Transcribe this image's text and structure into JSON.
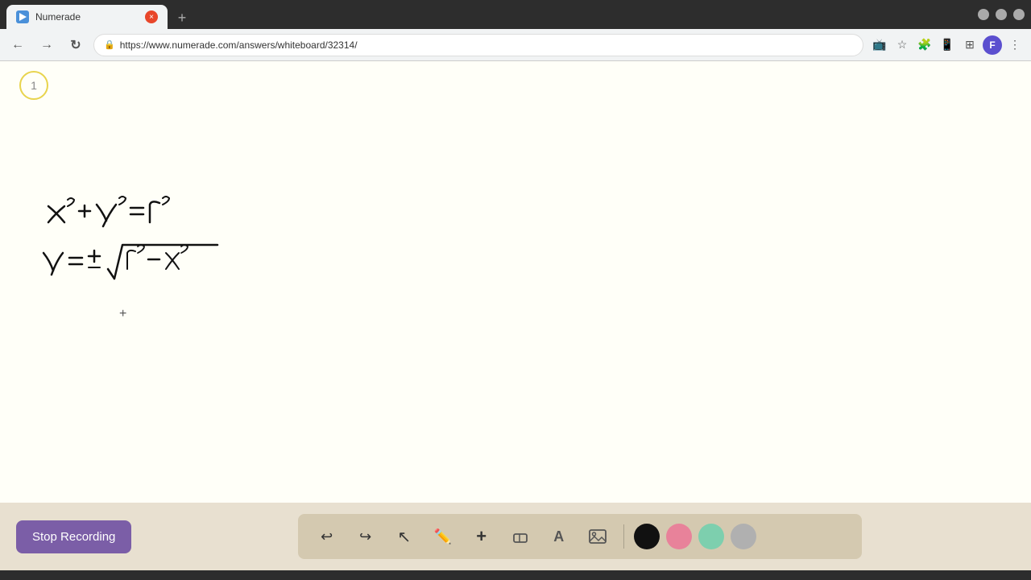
{
  "browser": {
    "tab": {
      "favicon_alt": "Numerade favicon",
      "title": "Numerade",
      "close_label": "×"
    },
    "new_tab_label": "+",
    "window_controls": {
      "minimize_label": "–",
      "maximize_label": "□",
      "close_label": "×"
    },
    "nav": {
      "back_label": "←",
      "forward_label": "→",
      "reload_label": "↻"
    },
    "url": "https://www.numerade.com/answers/whiteboard/32314/",
    "url_display": "https://www.numerade.com/answers/whiteboard/32314/",
    "profile_initial": "F"
  },
  "whiteboard": {
    "page_number": "1",
    "math_description": "Handwritten math equations: x²+y²=r² and y = ± √(r²-x²)"
  },
  "toolbar": {
    "stop_recording_label": "Stop Recording",
    "tools": [
      {
        "name": "undo",
        "icon": "↩",
        "label": "Undo"
      },
      {
        "name": "redo",
        "icon": "↪",
        "label": "Redo"
      },
      {
        "name": "select",
        "icon": "↖",
        "label": "Select"
      },
      {
        "name": "pen",
        "icon": "✏",
        "label": "Pen"
      },
      {
        "name": "add",
        "icon": "+",
        "label": "Add"
      },
      {
        "name": "eraser",
        "icon": "◻",
        "label": "Eraser"
      },
      {
        "name": "text",
        "icon": "A",
        "label": "Text"
      },
      {
        "name": "image",
        "icon": "🖼",
        "label": "Image"
      }
    ],
    "colors": [
      {
        "name": "black",
        "value": "#111111"
      },
      {
        "name": "pink",
        "value": "#e8829a"
      },
      {
        "name": "green",
        "value": "#7dcfae"
      },
      {
        "name": "gray",
        "value": "#b0b0b0"
      }
    ]
  }
}
